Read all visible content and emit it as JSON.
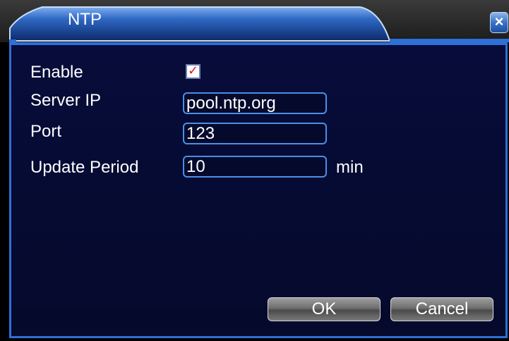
{
  "window": {
    "title": "NTP",
    "close_label": "×"
  },
  "form": {
    "enable_label": "Enable",
    "enable_checked": true,
    "server_ip_label": "Server IP",
    "server_ip_value": "pool.ntp.org",
    "port_label": "Port",
    "port_value": "123",
    "update_period_label": "Update Period",
    "update_period_value": "10",
    "update_period_unit": "min"
  },
  "buttons": {
    "ok_label": "OK",
    "cancel_label": "Cancel"
  },
  "colors": {
    "accent": "#2f6fd6",
    "panel_bg": "#050a2c",
    "check_mark": "#e01818"
  }
}
